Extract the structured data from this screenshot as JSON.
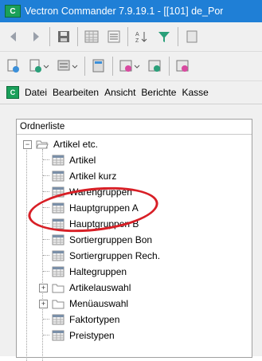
{
  "window": {
    "title": "Vectron Commander 7.9.19.1 - [[101] de_Por"
  },
  "app_icon_letter": "C",
  "toolbar1": {
    "icons": [
      "back-arrow-icon",
      "forward-arrow-icon",
      "save-icon",
      "table-grid-icon",
      "list-view-icon",
      "sort-icon",
      "filter-icon"
    ]
  },
  "toolbar2": {
    "icons": [
      "import-doc-icon",
      "export-doc-icon",
      "transfer-icon",
      "calc-icon",
      "send-icon",
      "receive-icon"
    ]
  },
  "menubar": {
    "items": [
      "Datei",
      "Bearbeiten",
      "Ansicht",
      "Berichte",
      "Kasse"
    ]
  },
  "tree": {
    "header": "Ordnerliste",
    "root": "Artikel etc.",
    "items": [
      {
        "label": "Artikel"
      },
      {
        "label": "Artikel kurz"
      },
      {
        "label": "Warengruppen"
      },
      {
        "label": "Hauptgruppen A"
      },
      {
        "label": "Hauptgruppen B"
      },
      {
        "label": "Sortiergruppen Bon"
      },
      {
        "label": "Sortiergruppen Rech."
      },
      {
        "label": "Haltegruppen"
      },
      {
        "label": "Artikelauswahl",
        "folder": true
      },
      {
        "label": "Menüauswahl",
        "folder": true
      },
      {
        "label": "Faktortypen"
      },
      {
        "label": "Preistypen"
      }
    ]
  },
  "colors": {
    "titlebar": "#1f7fd6",
    "highlight_circle": "#d81f26",
    "accent_green": "#1aa05a"
  }
}
